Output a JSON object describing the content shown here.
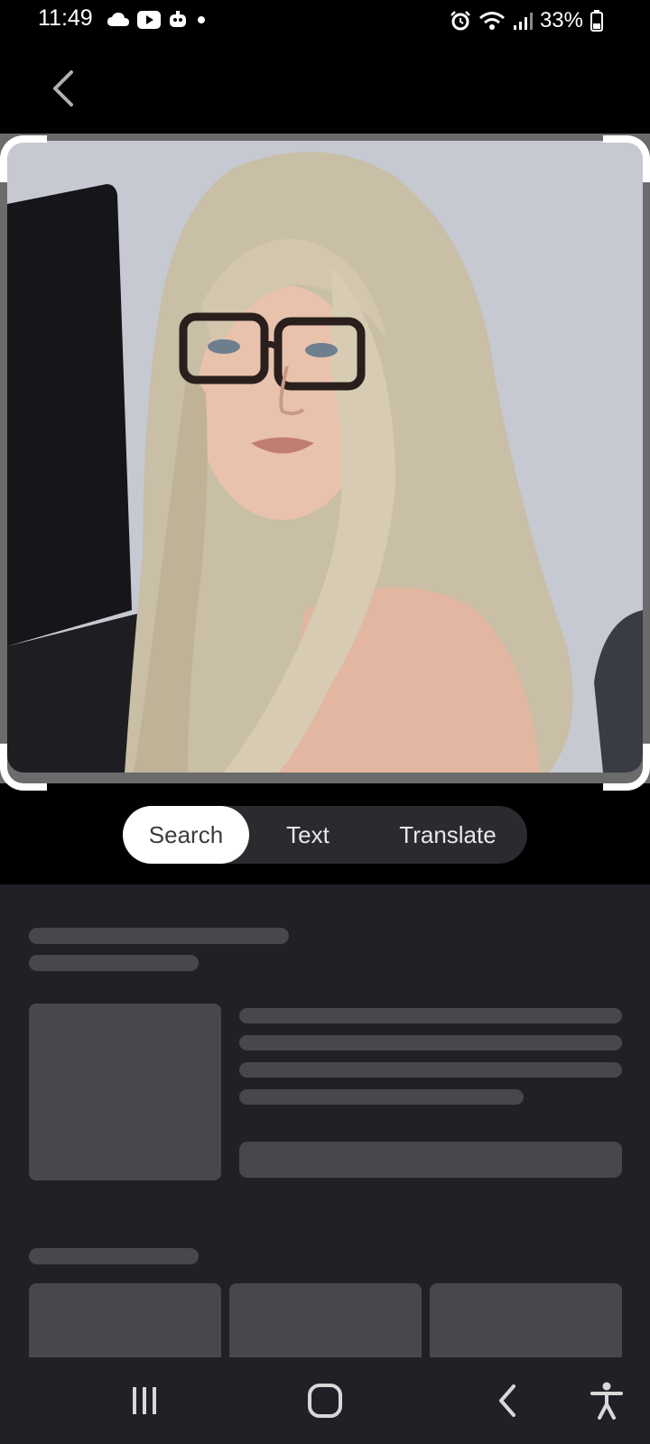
{
  "status_bar": {
    "time": "11:49",
    "battery": "33%",
    "left_icons": [
      "cloud-icon",
      "youtube-icon",
      "robot-icon",
      "dot-icon"
    ],
    "right_icons": [
      "alarm-icon",
      "wifi-icon",
      "signal-icon",
      "battery-icon"
    ]
  },
  "top_bar": {
    "back_icon": "chevron-left-icon"
  },
  "image": {
    "description_icon": "photo"
  },
  "mode_tabs": {
    "search": "Search",
    "text": "Text",
    "translate": "Translate",
    "selected": "Search"
  },
  "colors": {
    "background": "#000000",
    "sheet": "#202027",
    "skeleton": "#47474d",
    "tab_bg": "#2b2b2f",
    "tab_selected": "#ffffff"
  },
  "nav_bar": {
    "icons": [
      "recent-apps-icon",
      "home-icon",
      "back-icon",
      "accessibility-icon"
    ]
  }
}
